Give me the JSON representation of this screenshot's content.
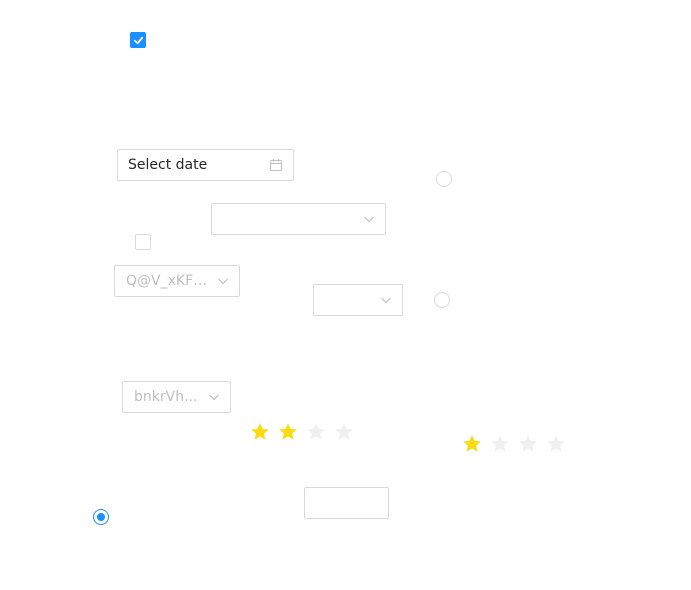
{
  "datepicker": {
    "placeholder": "Select date",
    "icon": "calendar-icon"
  },
  "selects": [
    {
      "value": ""
    },
    {
      "value": "Q@V_xKFz..."
    },
    {
      "value": ""
    },
    {
      "value": "bnkrVh..."
    }
  ],
  "text_input": {
    "value": ""
  },
  "checkboxes": [
    {
      "checked": true
    },
    {
      "checked": false
    }
  ],
  "radios": [
    {
      "checked": false
    },
    {
      "checked": false
    },
    {
      "checked": true
    }
  ],
  "rates": [
    {
      "value": 2,
      "max": 4
    },
    {
      "value": 1,
      "max": 4
    }
  ],
  "colors": {
    "primary": "#1890ff",
    "star_active": "#fadb14",
    "star_inactive": "#f0f0f0",
    "border": "#d9d9d9"
  }
}
